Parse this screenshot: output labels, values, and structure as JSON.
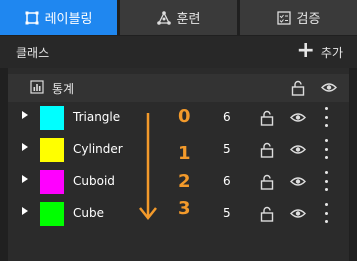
{
  "tabs": [
    {
      "label": "레이블링",
      "icon": "bbox-icon",
      "active": true
    },
    {
      "label": "훈련",
      "icon": "network-icon",
      "active": false
    },
    {
      "label": "검증",
      "icon": "checklist-icon",
      "active": false
    }
  ],
  "header": {
    "title": "클래스",
    "add_label": "추가"
  },
  "stats": {
    "label": "통계"
  },
  "classes": [
    {
      "name": "Triangle",
      "color": "#00ffff",
      "count": "6",
      "order": "0"
    },
    {
      "name": "Cylinder",
      "color": "#ffff00",
      "count": "5",
      "order": "1"
    },
    {
      "name": "Cuboid",
      "color": "#ff00ff",
      "count": "6",
      "order": "2"
    },
    {
      "name": "Cube",
      "color": "#00ff00",
      "count": "5",
      "order": "3"
    }
  ],
  "colors": {
    "accent": "#1f87f0",
    "annotation": "#f39a2b"
  }
}
